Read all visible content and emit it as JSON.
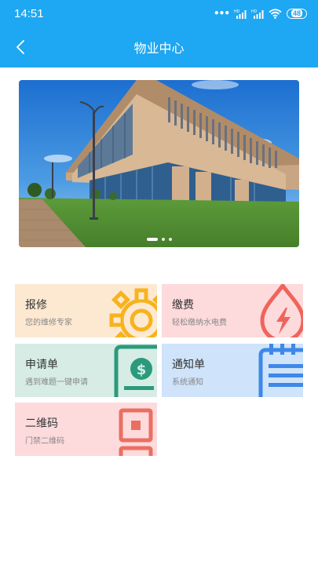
{
  "status": {
    "time": "14:51",
    "battery": "48",
    "hd1": "HD",
    "hd2": "HD"
  },
  "header": {
    "title": "物业中心"
  },
  "banner": {
    "slides": 3,
    "active_index": 0
  },
  "tiles": [
    {
      "title": "报修",
      "subtitle": "您的维修专家",
      "icon": "gear-icon",
      "bg": "#fde9d2",
      "icon_color": "#f6b31e"
    },
    {
      "title": "缴费",
      "subtitle": "轻松缴纳水电费",
      "icon": "drop-lightning-icon",
      "bg": "#fddadc",
      "icon_color": "#f0645b"
    },
    {
      "title": "申请单",
      "subtitle": "遇到难题一键申请",
      "icon": "dollar-document-icon",
      "bg": "#d6ece5",
      "icon_color": "#2b9a7c"
    },
    {
      "title": "通知单",
      "subtitle": "系统通知",
      "icon": "notepad-icon",
      "bg": "#cfe3fa",
      "icon_color": "#3d88e8"
    },
    {
      "title": "二维码",
      "subtitle": "门禁二维码",
      "icon": "qr-code-icon",
      "bg": "#fddadc",
      "icon_color": "#ea6f62"
    }
  ]
}
